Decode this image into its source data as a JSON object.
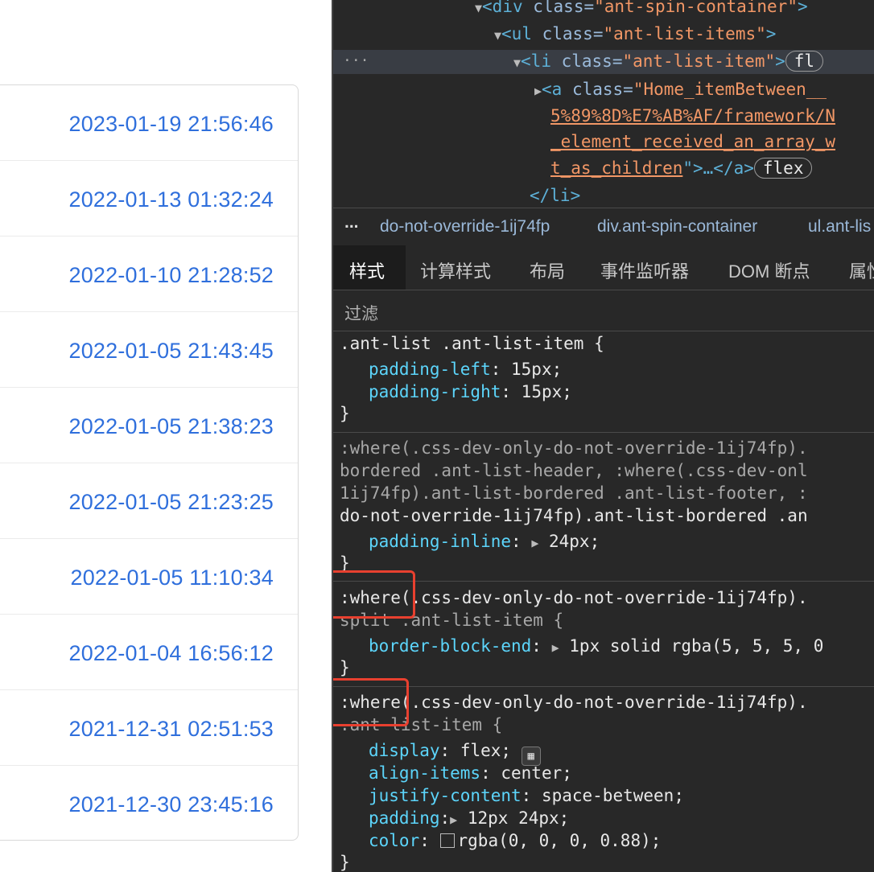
{
  "timestamps": [
    "2023-01-19 21:56:46",
    "2022-01-13 01:32:24",
    "2022-01-10 21:28:52",
    "2022-01-05 21:43:45",
    "2022-01-05 21:38:23",
    "2022-01-05 21:23:25",
    "2022-01-05 11:10:34",
    "2022-01-04 16:56:12",
    "2021-12-31 02:51:53",
    "2021-12-30 23:45:16"
  ],
  "elements": {
    "line1_tag": "<div ",
    "line1_attr": "class=",
    "line1_val": "\"ant-spin-container\"",
    "line1_end": ">",
    "line2_tag": "<ul ",
    "line2_attr": "class=",
    "line2_val": "\"ant-list-items\"",
    "line2_end": ">",
    "line3_tag": "<li ",
    "line3_attr": "class=",
    "line3_val": "\"ant-list-item\"",
    "line3_end": ">",
    "line3_badge": "fl",
    "line4_tag": "<a ",
    "line4_attr": "class=",
    "line4_val": "\"Home_itemBetween__",
    "line5": "5%89%8D%E7%AB%AF/framework/N",
    "line6": "_element_received_an_array_w",
    "line7": "t_as_children",
    "line7_end": "\">…</a>",
    "line7_badge": "flex",
    "line8": "</li>",
    "ellipsis": "···"
  },
  "breadcrumbs": {
    "more": "...",
    "item1": "do-not-override-1ij74fp",
    "item2": "div.ant-spin-container",
    "item3": "ul.ant-lis"
  },
  "tabs": [
    "样式",
    "计算样式",
    "布局",
    "事件监听器",
    "DOM 断点",
    "属性"
  ],
  "filter_placeholder": "过滤",
  "rules": {
    "r1_selector": ".ant-list .ant-list-item {",
    "r1_p1": "padding-left",
    "r1_v1": "15px;",
    "r1_p2": "padding-right",
    "r1_v2": "15px;",
    "r2_s1": ":where(.css-dev-only-do-not-override-1ij74fp).",
    "r2_s2": "bordered .ant-list-header, :where(.css-dev-onl",
    "r2_s3": "1ij74fp).ant-list-bordered .ant-list-footer, :",
    "r2_s4": "do-not-override-1ij74fp).ant-list-bordered .an",
    "r2_p1": "padding-inline",
    "r2_v1": "24px;",
    "r3_s1": ":where(.css-dev-only-do-not-override-1ij74fp).",
    "r3_s2": "split .ant-list-item {",
    "r3_p1": "border-block-end",
    "r3_v1": "1px solid rgba(5, 5, 5, 0",
    "r4_s1": ":where(.css-dev-only-do-not-override-1ij74fp).",
    "r4_s2": ".ant-list-item {",
    "r4_p1": "display",
    "r4_v1": "flex;",
    "r4_p2": "align-items",
    "r4_v2": "center;",
    "r4_p3": "justify-content",
    "r4_v3": "space-between;",
    "r4_p4": "padding",
    "r4_v4": "12px 24px;",
    "r4_p5": "color",
    "r4_v5": "rgba(0, 0, 0, 0.88);",
    "close": "}"
  },
  "colors": {
    "link": "#2f6fdc",
    "devtools_bg": "#282828",
    "highlight": "#e8402f",
    "property": "#5cd5fb",
    "string": "#f29766"
  }
}
